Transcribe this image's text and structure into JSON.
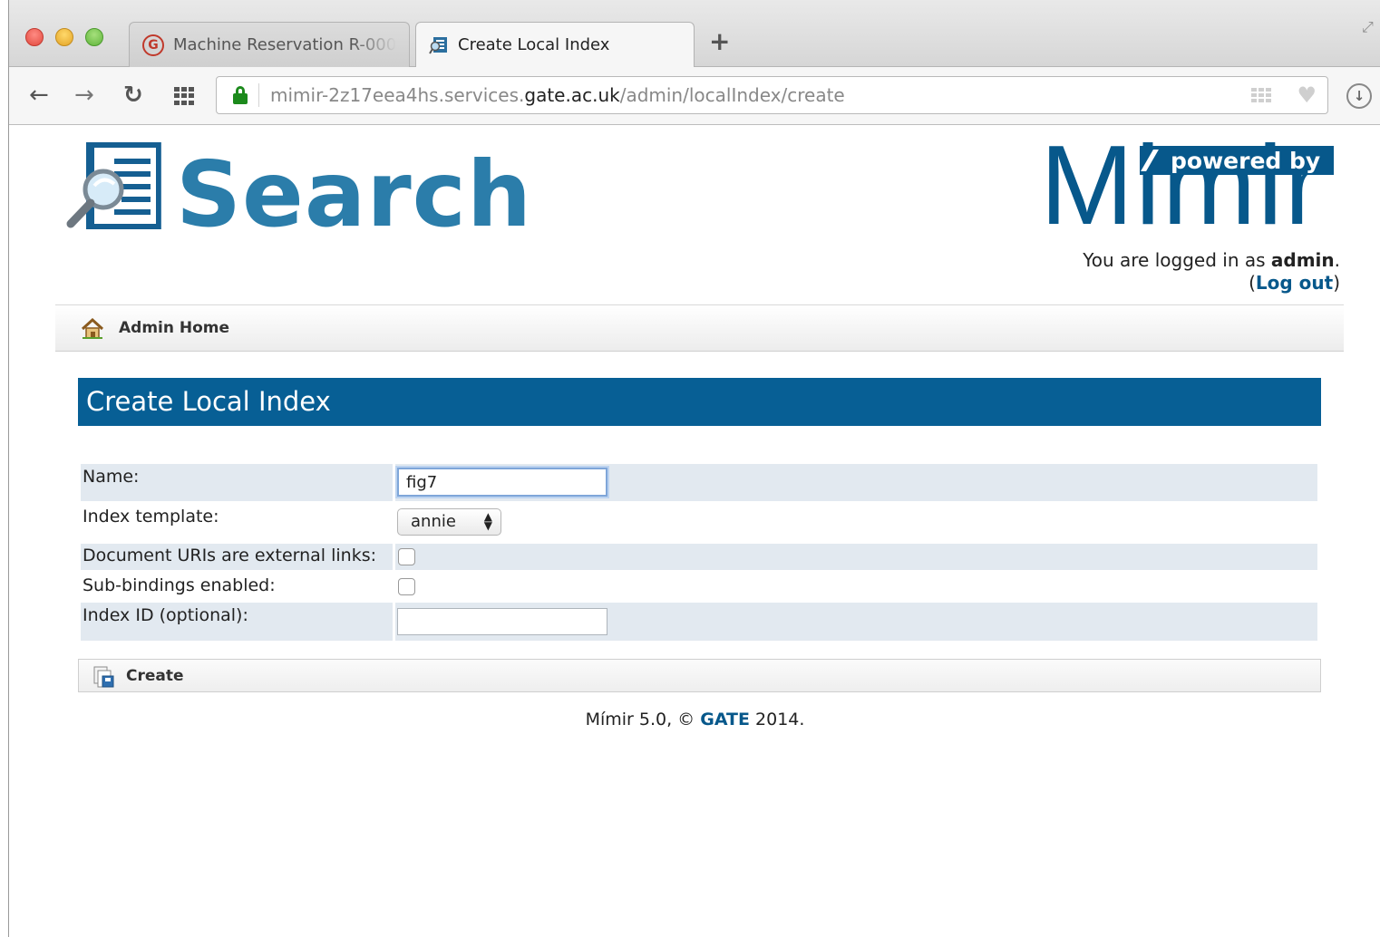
{
  "browser": {
    "tabs": [
      {
        "label": "Machine Reservation R-000",
        "favicon": "gate-icon",
        "active": false
      },
      {
        "label": "Create Local Index",
        "favicon": "search-doc-icon",
        "active": true
      }
    ],
    "new_tab_glyph": "+",
    "url": {
      "prefix": "mimir-2z17eea4hs.services.",
      "domain": "gate.ac.uk",
      "path": "/admin/localIndex/create"
    }
  },
  "header": {
    "search_wordmark": "Search",
    "mimir_wordmark": "Mimir",
    "powered_by": "powered by",
    "login_prefix": "You are logged in as ",
    "login_user": "admin",
    "login_suffix": ".",
    "logout_open": "(",
    "logout_label": "Log out",
    "logout_close": ")"
  },
  "nav": {
    "home_label": "Admin Home"
  },
  "page": {
    "title": "Create Local Index"
  },
  "form": {
    "name_label": "Name:",
    "name_value": "fig7",
    "template_label": "Index template:",
    "template_value": "annie",
    "external_links_label": "Document URIs are external links:",
    "external_links_checked": false,
    "subbindings_label": "Sub-bindings enabled:",
    "subbindings_checked": false,
    "index_id_label": "Index ID (optional):",
    "index_id_value": "",
    "create_label": "Create"
  },
  "footer": {
    "prefix": "Mímir 5.0, © ",
    "link": "GATE",
    "suffix": " 2014."
  },
  "colors": {
    "brand_blue": "#07588b",
    "search_blue": "#2b7daa",
    "row_shade": "#e2e9f0"
  }
}
